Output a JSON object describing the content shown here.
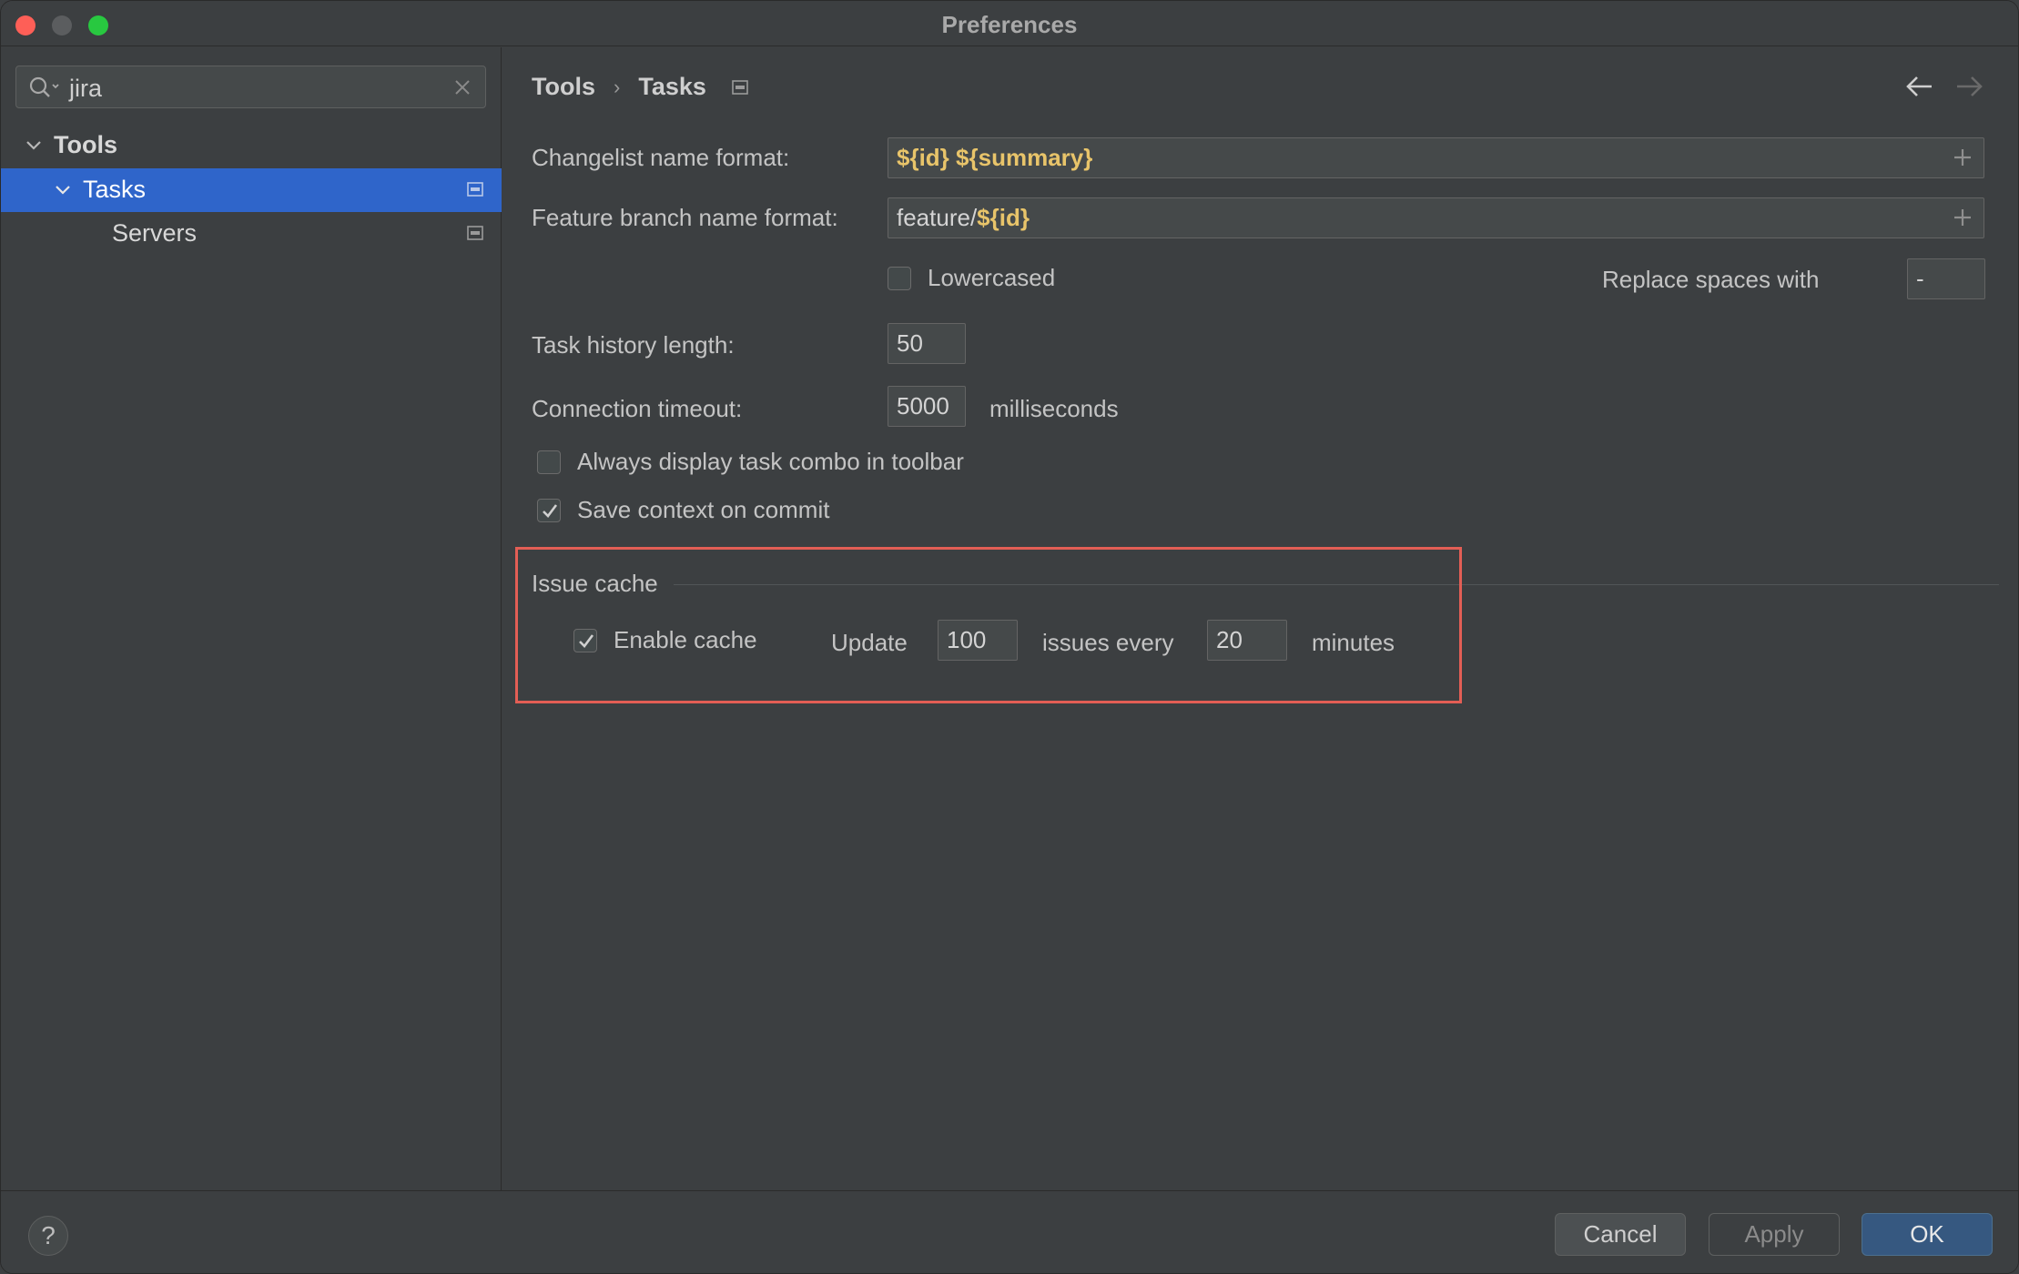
{
  "window": {
    "title": "Preferences"
  },
  "sidebar": {
    "search_value": "jira",
    "tree": [
      {
        "label": "Tools",
        "level": 0,
        "expanded": true,
        "selected": false
      },
      {
        "label": "Tasks",
        "level": 1,
        "expanded": true,
        "selected": true
      },
      {
        "label": "Servers",
        "level": 2,
        "expanded": false,
        "selected": false
      }
    ]
  },
  "breadcrumb": {
    "parent": "Tools",
    "separator": "›",
    "current": "Tasks"
  },
  "form": {
    "changelist_label": "Changelist name format:",
    "changelist_value": {
      "macro1": "${id}",
      "space": " ",
      "macro2": "${summary}"
    },
    "branch_label": "Feature branch name format:",
    "branch_value": {
      "prefix": "feature/",
      "macro": "${id}"
    },
    "lowercased_label": "Lowercased",
    "lowercased_checked": false,
    "replace_spaces_label": "Replace spaces with",
    "replace_spaces_value": "-",
    "history_label": "Task history length:",
    "history_value": "50",
    "timeout_label": "Connection timeout:",
    "timeout_value": "5000",
    "timeout_unit": "milliseconds",
    "always_display_label": "Always display task combo in toolbar",
    "always_display_checked": false,
    "save_context_label": "Save context on commit",
    "save_context_checked": true
  },
  "issue_cache": {
    "title": "Issue cache",
    "enable_label": "Enable cache",
    "enable_checked": true,
    "update_label": "Update",
    "update_value": "100",
    "issues_every_label": "issues every",
    "interval_value": "20",
    "minutes_label": "minutes"
  },
  "footer": {
    "help_label": "?",
    "cancel_label": "Cancel",
    "apply_label": "Apply",
    "ok_label": "OK"
  },
  "colors": {
    "accent_selection": "#2f65ca",
    "ok_button": "#365880",
    "highlight_box": "#e35e55",
    "macro_text": "#e8c46a"
  }
}
